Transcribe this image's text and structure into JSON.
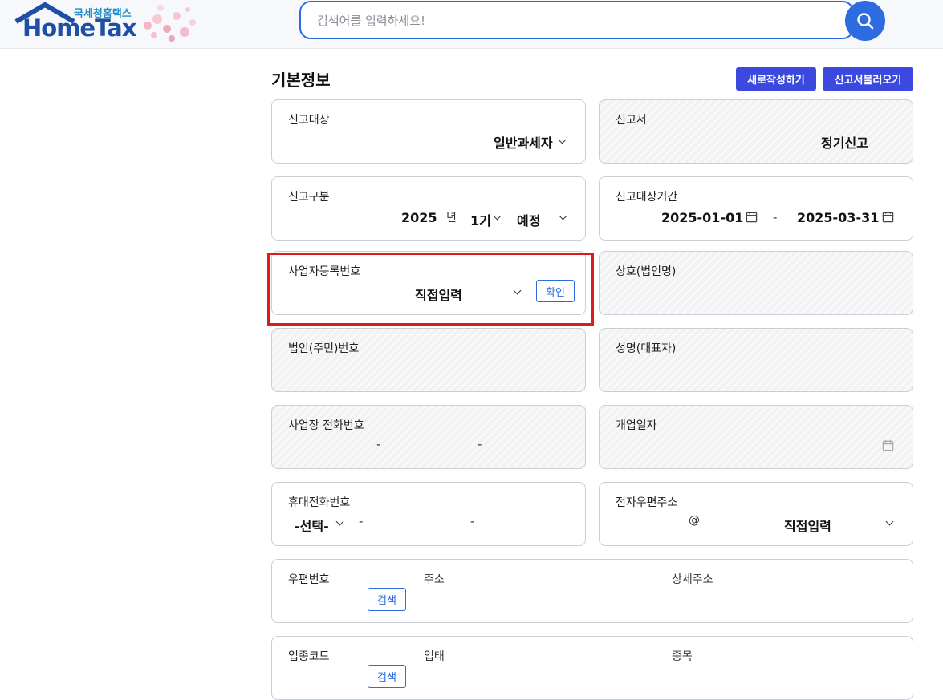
{
  "header": {
    "logo_sub": "국세청홈택스",
    "logo_main": "HomeTax",
    "search_placeholder": "검색어를 입력하세요!"
  },
  "section": {
    "title": "기본정보",
    "new_button": "새로작성하기",
    "load_button": "신고서불러오기"
  },
  "fields": {
    "report_target": {
      "label": "신고대상",
      "value": "일반과세자"
    },
    "report_form": {
      "label": "신고서",
      "value": "정기신고"
    },
    "report_type": {
      "label": "신고구분",
      "year": "2025",
      "year_unit": "년",
      "period": "1기",
      "kind": "예정"
    },
    "report_period": {
      "label": "신고대상기간",
      "start": "2025-01-01",
      "separator": "-",
      "end": "2025-03-31"
    },
    "biz_reg_no": {
      "label": "사업자등록번호",
      "value": "직접입력",
      "confirm": "확인"
    },
    "company_name": {
      "label": "상호(법인명)"
    },
    "corp_no": {
      "label": "법인(주민)번호"
    },
    "rep_name": {
      "label": "성명(대표자)"
    },
    "biz_phone": {
      "label": "사업장 전화번호",
      "dash1": "-",
      "dash2": "-"
    },
    "open_date": {
      "label": "개업일자"
    },
    "mobile": {
      "label": "휴대전화번호",
      "prefix": "-선택-",
      "dash1": "-",
      "dash2": "-"
    },
    "email": {
      "label": "전자우편주소",
      "at": "@",
      "domain": "직접입력"
    },
    "address": {
      "zip_label": "우편번호",
      "search": "검색",
      "addr_label": "주소",
      "detail_label": "상세주소"
    },
    "industry": {
      "code_label": "업종코드",
      "search": "검색",
      "type_label": "업태",
      "item_label": "종목"
    }
  }
}
